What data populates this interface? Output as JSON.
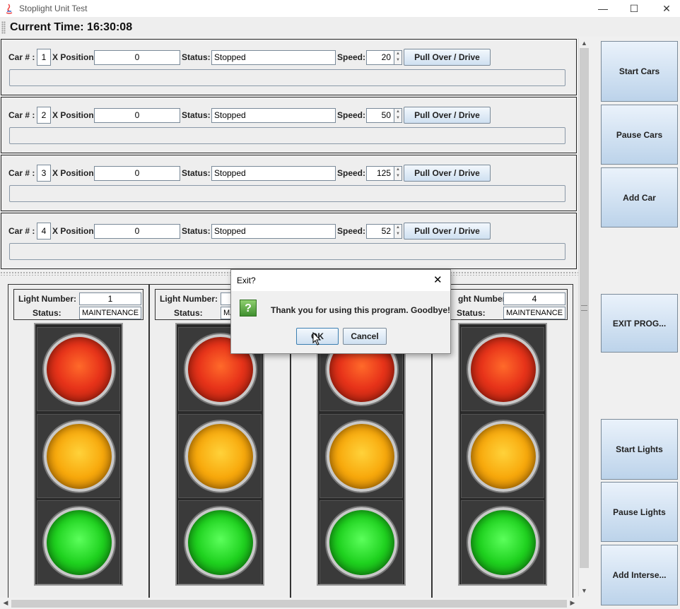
{
  "window": {
    "title": "Stoplight Unit Test",
    "minimize": "—",
    "maximize": "☐",
    "close": "✕"
  },
  "clock": {
    "label": "Current Time: 16:30:08"
  },
  "labels": {
    "car_num": "Car # :",
    "x_position": "X Position:",
    "status": "Status:",
    "speed": "Speed:",
    "light_number": "Light Number:",
    "light_status": "Status:"
  },
  "cars": [
    {
      "number": "1",
      "x_position": "0",
      "status": "Stopped",
      "speed": "20",
      "button": "Pull Over / Drive",
      "progress": 0
    },
    {
      "number": "2",
      "x_position": "0",
      "status": "Stopped",
      "speed": "50",
      "button": "Pull Over / Drive",
      "progress": 0
    },
    {
      "number": "3",
      "x_position": "0",
      "status": "Stopped",
      "speed": "125",
      "button": "Pull Over / Drive",
      "progress": 0
    },
    {
      "number": "4",
      "x_position": "0",
      "status": "Stopped",
      "speed": "52",
      "button": "Pull Over / Drive",
      "progress": 0
    }
  ],
  "lights": [
    {
      "number": "1",
      "status": "MAINTENANCE"
    },
    {
      "number": "",
      "status": "MA"
    },
    {
      "number": "",
      "status": ""
    },
    {
      "number": "4",
      "status": "MAINTENANCE"
    }
  ],
  "partial_light_label": "ght Number:",
  "sidebar": {
    "start_cars": "Start Cars",
    "pause_cars": "Pause Cars",
    "add_car": "Add Car",
    "exit_program": "EXIT PROG...",
    "start_lights": "Start Lights",
    "pause_lights": "Pause Lights",
    "add_intersection": "Add Interse..."
  },
  "dialog": {
    "title": "Exit?",
    "message": "Thank you for using this program. Goodbye!",
    "ok": "OK",
    "cancel": "Cancel",
    "close": "✕",
    "icon": "question-icon"
  },
  "colors": {
    "red_lamp": "#e8341a",
    "yellow_lamp": "#f8a90c",
    "green_lamp": "#1fd21f",
    "button_gradient_bottom": "#cfe0f1"
  }
}
